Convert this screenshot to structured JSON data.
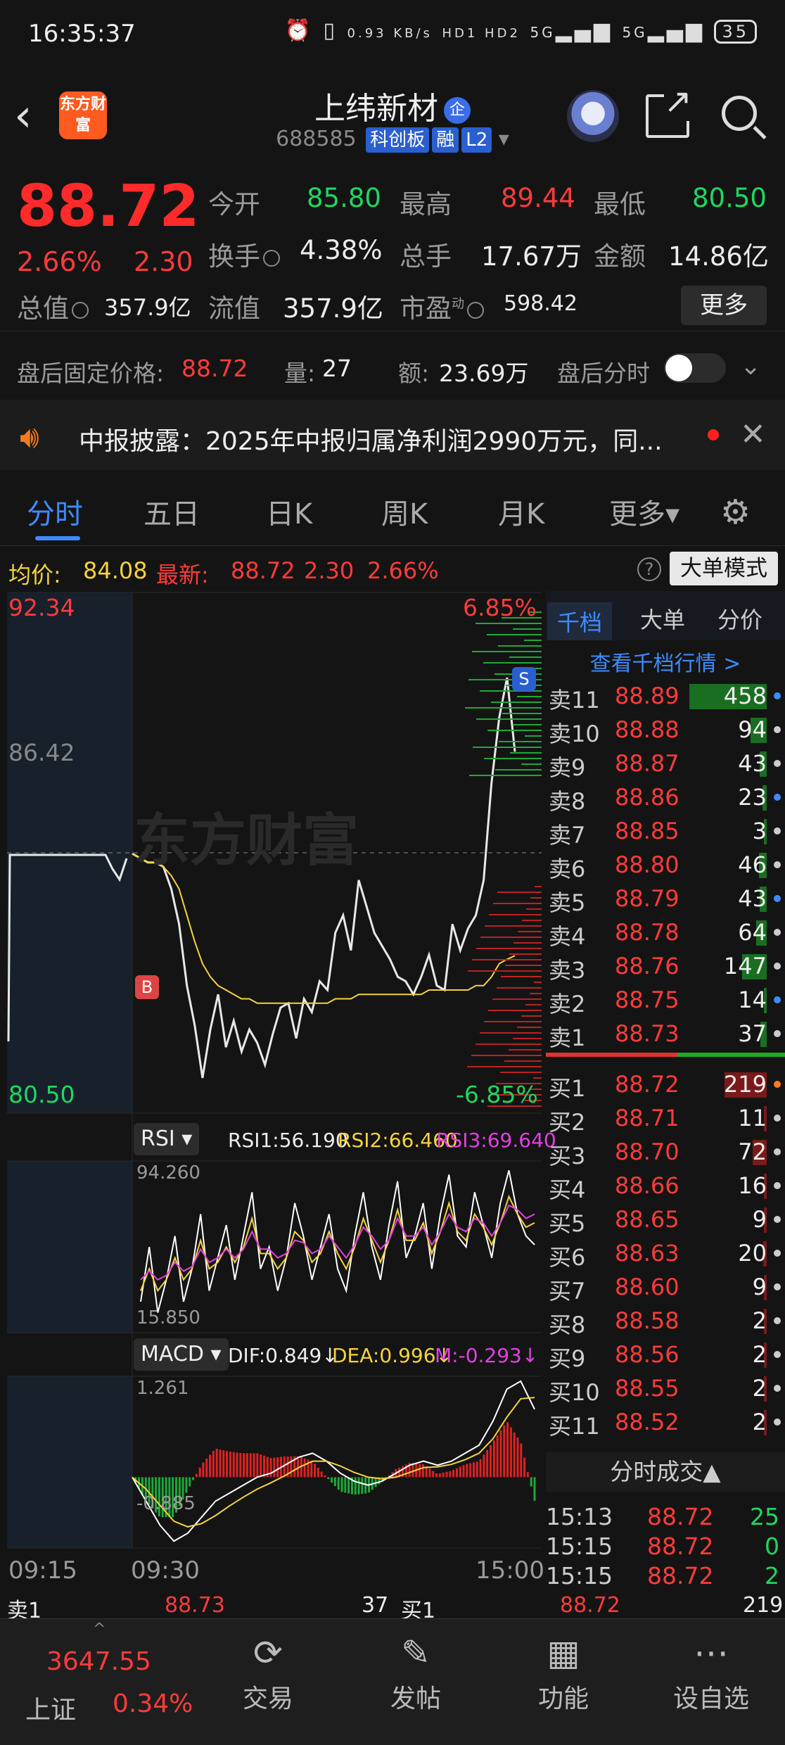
{
  "status": {
    "time": "16:35:37",
    "net_speed": "0.93 KB/s",
    "hd": "HD1 HD2",
    "sig1": "5G",
    "sig2": "5G",
    "battery": "35"
  },
  "header": {
    "logo_text": "东方财富",
    "name": "上纬新材",
    "name_badge": "企",
    "code": "688585",
    "tags": [
      "科创板",
      "融",
      "L2"
    ]
  },
  "quote": {
    "price": "88.72",
    "pct": "2.66%",
    "change": "2.30",
    "open_label": "今开",
    "open": "85.80",
    "high_label": "最高",
    "high": "89.44",
    "low_label": "最低",
    "low": "80.50",
    "turnover_label": "换手",
    "turnover": "4.38%",
    "volume_label": "总手",
    "volume": "17.67万",
    "amount_label": "金额",
    "amount": "14.86亿",
    "mktcap_label": "总值",
    "mktcap": "357.9亿",
    "float_label": "流值",
    "float": "357.9亿",
    "pe_label": "市盈",
    "pe_sup": "动",
    "pe": "598.42",
    "more": "更多"
  },
  "afterhours": {
    "label": "盘后固定价格:",
    "price": "88.72",
    "vol_label": "量:",
    "vol": "27",
    "amt_label": "额:",
    "amt": "23.69万",
    "timeshare_label": "盘后分时"
  },
  "notice": {
    "text": "中报披露：2025年中报归属净利润2990万元，同..."
  },
  "tabs": [
    "分时",
    "五日",
    "日K",
    "周K",
    "月K",
    "更多▾"
  ],
  "infobar": {
    "avg_label": "均价:",
    "avg": "84.08",
    "last_label": "最新:",
    "last": "88.72",
    "chg": "2.30",
    "pct": "2.66%",
    "mode": "大单模式"
  },
  "chart_data": [
    {
      "type": "line",
      "title": "分时",
      "y_top": "92.34",
      "y_bottom": "80.50",
      "pct_top": "6.85%",
      "pct_bottom": "-6.85%",
      "prev_close": "86.42",
      "watermark": "东方财富",
      "x_labels": [
        "09:15",
        "09:30",
        "15:00"
      ],
      "ylim": [
        80.5,
        92.34
      ],
      "series": [
        {
          "values": [
            86.4,
            86.3,
            86.2,
            86.2,
            86.1,
            85.6,
            84.8,
            83.4,
            82.5,
            81.3,
            82.4,
            83.2,
            82.0,
            82.6,
            81.9,
            82.4,
            82.1,
            81.6,
            82.3,
            82.9,
            83.0,
            82.2,
            83.1,
            82.8,
            83.5,
            83.3,
            84.6,
            85.0,
            84.2,
            85.8,
            85.2,
            84.6,
            84.3,
            84.0,
            83.6,
            83.5,
            83.2,
            83.6,
            84.1,
            83.4,
            83.3,
            84.8,
            84.2,
            84.7,
            85.0,
            85.8,
            88.0,
            89.5,
            90.4,
            88.72
          ],
          "color": "#e8e8e8"
        },
        {
          "values": [
            86.4,
            86.3,
            86.2,
            86.2,
            86.1,
            85.9,
            85.6,
            85.0,
            84.4,
            83.9,
            83.6,
            83.4,
            83.3,
            83.2,
            83.1,
            83.1,
            83.0,
            83.0,
            83.0,
            83.0,
            83.0,
            83.0,
            83.0,
            83.0,
            83.0,
            83.0,
            83.1,
            83.1,
            83.1,
            83.2,
            83.2,
            83.2,
            83.2,
            83.2,
            83.2,
            83.2,
            83.2,
            83.2,
            83.3,
            83.3,
            83.3,
            83.3,
            83.3,
            83.3,
            83.4,
            83.4,
            83.6,
            83.9,
            84.0,
            84.08
          ],
          "color": "#f5d33c"
        }
      ]
    },
    {
      "type": "line",
      "title": "RSI",
      "y_top_label": "94.260",
      "y_bottom_label": "15.850",
      "ylim": [
        15.85,
        94.26
      ],
      "series": [
        {
          "name": "RSI1:56.190",
          "color": "#ffffff",
          "values": [
            30,
            55,
            25,
            40,
            60,
            30,
            45,
            70,
            35,
            50,
            65,
            40,
            60,
            80,
            45,
            55,
            35,
            50,
            75,
            60,
            40,
            55,
            70,
            45,
            35,
            60,
            80,
            55,
            40,
            65,
            85,
            50,
            60,
            75,
            45,
            70,
            88,
            60,
            55,
            80,
            65,
            50,
            75,
            90,
            70,
            60,
            56
          ]
        },
        {
          "name": "RSI2:66.460",
          "color": "#f5d33c",
          "values": [
            35,
            45,
            35,
            40,
            50,
            40,
            45,
            58,
            45,
            48,
            55,
            48,
            55,
            68,
            52,
            52,
            45,
            50,
            62,
            58,
            48,
            52,
            62,
            52,
            45,
            55,
            68,
            58,
            48,
            58,
            72,
            58,
            58,
            66,
            52,
            62,
            75,
            62,
            58,
            70,
            64,
            56,
            66,
            78,
            70,
            64,
            66
          ]
        },
        {
          "name": "RSI3:69.640",
          "color": "#e041e0",
          "values": [
            40,
            44,
            40,
            42,
            48,
            44,
            46,
            54,
            48,
            50,
            54,
            50,
            54,
            62,
            54,
            54,
            50,
            52,
            58,
            57,
            52,
            54,
            60,
            55,
            50,
            56,
            64,
            60,
            54,
            58,
            68,
            60,
            60,
            64,
            56,
            62,
            70,
            64,
            62,
            68,
            66,
            60,
            66,
            74,
            72,
            68,
            70
          ]
        }
      ]
    },
    {
      "type": "line",
      "title": "MACD",
      "y_top_label": "1.261",
      "y_bottom_label": "-0.885",
      "ylim": [
        -0.885,
        1.261
      ],
      "series": [
        {
          "name": "DIF:0.849↓",
          "color": "#ffffff",
          "values": [
            0,
            -0.3,
            -0.6,
            -0.8,
            -0.7,
            -0.5,
            -0.3,
            -0.2,
            -0.1,
            0.0,
            0.05,
            0.15,
            0.25,
            0.3,
            0.2,
            0.05,
            -0.05,
            -0.1,
            -0.05,
            0.05,
            0.15,
            0.2,
            0.15,
            0.2,
            0.3,
            0.4,
            0.7,
            1.1,
            1.2,
            0.849
          ]
        },
        {
          "name": "DEA:0.996↓",
          "color": "#f5d33c",
          "values": [
            0,
            -0.15,
            -0.35,
            -0.55,
            -0.62,
            -0.58,
            -0.48,
            -0.36,
            -0.25,
            -0.15,
            -0.07,
            0.02,
            0.12,
            0.2,
            0.2,
            0.14,
            0.06,
            0.0,
            -0.02,
            0.0,
            0.06,
            0.12,
            0.13,
            0.16,
            0.22,
            0.3,
            0.48,
            0.75,
            0.98,
            0.996
          ]
        },
        {
          "name": "M:-0.293↓",
          "color": "#e041e0",
          "values": []
        }
      ]
    }
  ],
  "order_book": {
    "tabs": [
      "千档",
      "大单",
      "分价"
    ],
    "link": "查看千档行情 >",
    "asks": [
      {
        "label": "卖11",
        "price": "88.89",
        "vol": "458"
      },
      {
        "label": "卖10",
        "price": "88.88",
        "vol": "94"
      },
      {
        "label": "卖9",
        "price": "88.87",
        "vol": "43"
      },
      {
        "label": "卖8",
        "price": "88.86",
        "vol": "23"
      },
      {
        "label": "卖7",
        "price": "88.85",
        "vol": "3"
      },
      {
        "label": "卖6",
        "price": "88.80",
        "vol": "46"
      },
      {
        "label": "卖5",
        "price": "88.79",
        "vol": "43"
      },
      {
        "label": "卖4",
        "price": "88.78",
        "vol": "64"
      },
      {
        "label": "卖3",
        "price": "88.76",
        "vol": "147"
      },
      {
        "label": "卖2",
        "price": "88.75",
        "vol": "14"
      },
      {
        "label": "卖1",
        "price": "88.73",
        "vol": "37"
      }
    ],
    "bids": [
      {
        "label": "买1",
        "price": "88.72",
        "vol": "219"
      },
      {
        "label": "买2",
        "price": "88.71",
        "vol": "11"
      },
      {
        "label": "买3",
        "price": "88.70",
        "vol": "72"
      },
      {
        "label": "买4",
        "price": "88.66",
        "vol": "16"
      },
      {
        "label": "买5",
        "price": "88.65",
        "vol": "9"
      },
      {
        "label": "买6",
        "price": "88.63",
        "vol": "20"
      },
      {
        "label": "买7",
        "price": "88.60",
        "vol": "9"
      },
      {
        "label": "买8",
        "price": "88.58",
        "vol": "2"
      },
      {
        "label": "买9",
        "price": "88.56",
        "vol": "2"
      },
      {
        "label": "买10",
        "price": "88.55",
        "vol": "2"
      },
      {
        "label": "买11",
        "price": "88.52",
        "vol": "2"
      }
    ],
    "ticks_title": "分时成交▲",
    "ticks": [
      {
        "time": "15:13",
        "price": "88.72",
        "vol": "25"
      },
      {
        "time": "15:15",
        "price": "88.72",
        "vol": "0"
      },
      {
        "time": "15:15",
        "price": "88.72",
        "vol": "2"
      }
    ]
  },
  "summary": {
    "ask_label": "卖1",
    "ask_price": "88.73",
    "ask_vol": "37",
    "bid_label": "买1",
    "bid_price": "88.72",
    "bid_vol": "219"
  },
  "bottom_nav": {
    "index_value": "3647.55",
    "index_name": "上证",
    "index_pct": "0.34%",
    "items": [
      {
        "label": "交易",
        "icon": "exchange-icon"
      },
      {
        "label": "发帖",
        "icon": "edit-icon"
      },
      {
        "label": "功能",
        "icon": "grid-icon"
      },
      {
        "label": "设自选",
        "icon": "more-icon"
      }
    ]
  },
  "colors": {
    "up": "#ff3b3b",
    "down": "#1ed760",
    "accent": "#3d8bff",
    "avg_line": "#f5d33c"
  }
}
